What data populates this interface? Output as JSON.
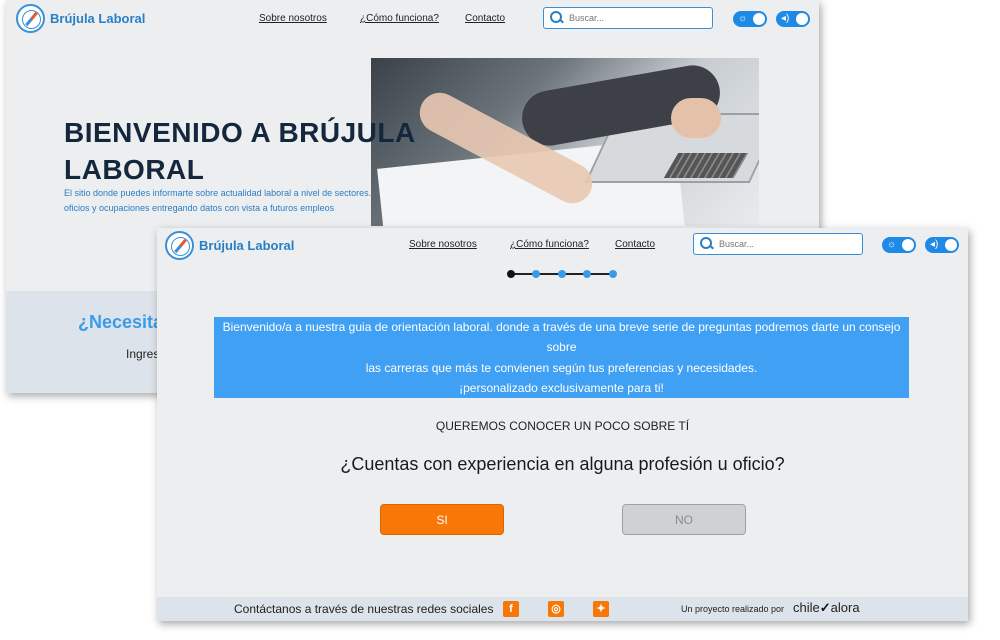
{
  "back_page": {
    "logo_text": "Brújula Laboral",
    "nav": [
      "Sobre nosotros",
      "¿Cómo funciona?",
      "Contacto"
    ],
    "search_placeholder": "Buscar...",
    "hero_title": "BIENVENIDO A BRÚJULA LABORAL",
    "hero_subtitle": "El sitio donde puedes informarte sobre actualidad laboral a nivel de sectores. oficios y ocupaciones entregando datos con vista a futuros empleos",
    "section_heading": "¿Necesita",
    "section_text": "Ingres"
  },
  "front_page": {
    "logo_text": "Brújula Laboral",
    "nav": [
      "Sobre nosotros",
      "¿Cómo funciona?",
      "Contacto"
    ],
    "search_placeholder": "Buscar...",
    "progress": {
      "total_steps": 5,
      "current_step": 1
    },
    "banner_lines": [
      "Bienvenido/a a nuestra guia de orientación laboral. donde a través de una breve serie de preguntas podremos darte un consejo sobre",
      "las carreras que más te convienen según tus preferencias y necesidades.",
      "¡personalizado exclusivamente para ti!"
    ],
    "section_label": "QUEREMOS CONOCER UN POCO SOBRE TÍ",
    "question": "¿Cuentas con experiencia en alguna profesión u oficio?",
    "yes_label": "SI",
    "no_label": "NO",
    "footer": {
      "contact_text": "Contáctanos a través de nuestras redes sociales",
      "social": [
        {
          "icon": "facebook-icon",
          "glyph": "f"
        },
        {
          "icon": "instagram-icon",
          "glyph": "◎"
        },
        {
          "icon": "twitter-icon",
          "glyph": "✦"
        }
      ],
      "project_text": "Un proyecto realizado por",
      "brand_left": "chile",
      "brand_check": "✓",
      "brand_right": "alora"
    }
  },
  "colors": {
    "accent": "#3a9be8",
    "banner": "#40a0f4",
    "orange": "#f77807",
    "background": "#eceef0"
  }
}
